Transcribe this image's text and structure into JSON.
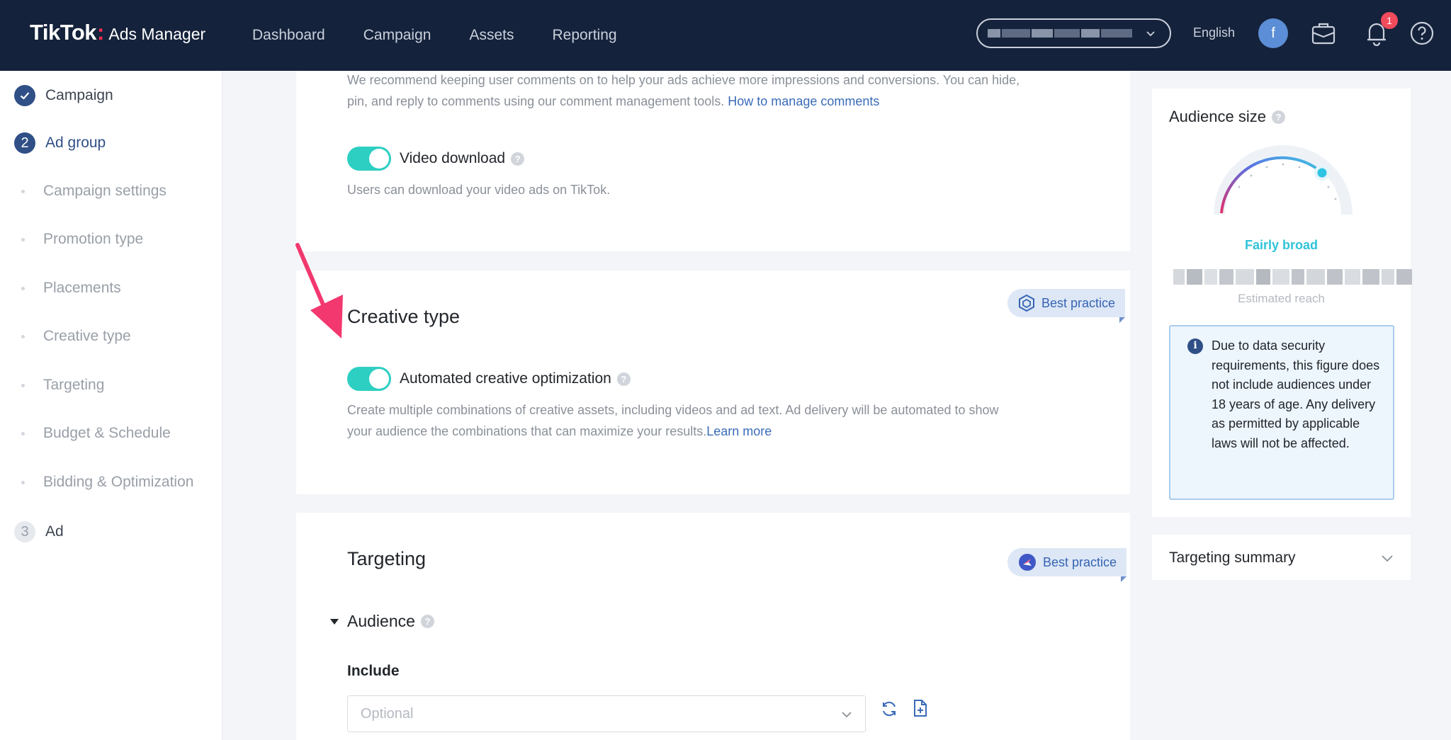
{
  "header": {
    "logo_brand": "TikTok",
    "logo_colon": ":",
    "logo_product": "Ads Manager",
    "nav": [
      "Dashboard",
      "Campaign",
      "Assets",
      "Reporting"
    ],
    "language": "English",
    "avatar_initial": "f",
    "notification_count": "1"
  },
  "sidebar": {
    "steps": [
      {
        "label": "Campaign",
        "marker": "check",
        "status": "done"
      },
      {
        "label": "Ad group",
        "marker": "2",
        "status": "active"
      },
      {
        "label": "Ad",
        "marker": "3",
        "status": "pending"
      }
    ],
    "sub_items": [
      "Campaign settings",
      "Promotion type",
      "Placements",
      "Creative type",
      "Targeting",
      "Budget & Schedule",
      "Bidding & Optimization"
    ]
  },
  "comments_card": {
    "desc_line1": "We recommend keeping user comments on to help your ads achieve more impressions and conversions. You can hide,",
    "desc_line2": "pin, and reply to comments using our comment management tools. ",
    "link": "How to manage comments",
    "video_download_label": "Video download",
    "video_download_desc": "Users can download your video ads on TikTok.",
    "video_download_on": true
  },
  "creative_card": {
    "title": "Creative type",
    "best_practice": "Best practice",
    "aco_label": "Automated creative optimization",
    "aco_on": true,
    "desc_line1": "Create multiple combinations of creative assets, including videos and ad text. Ad delivery will be automated to show",
    "desc_line2": "your audience the combinations that can maximize your results.",
    "link": "Learn more"
  },
  "targeting_card": {
    "title": "Targeting",
    "best_practice": "Best practice",
    "audience_label": "Audience",
    "include_label": "Include",
    "include_placeholder": "Optional"
  },
  "audience_panel": {
    "title": "Audience size",
    "level": "Fairly broad",
    "reach_label": "Estimated reach",
    "info": "Due to data security requirements, this figure does not include audiences under 18 years of age. Any delivery as permitted by applicable laws will not be affected.",
    "targeting_summary": "Targeting summary"
  },
  "colors": {
    "topbar": "#15223b",
    "accent_teal": "#2dcfc2",
    "link_blue": "#3a6bb8",
    "step_active": "#2f4f86",
    "arrow_pink": "#f2386e"
  }
}
